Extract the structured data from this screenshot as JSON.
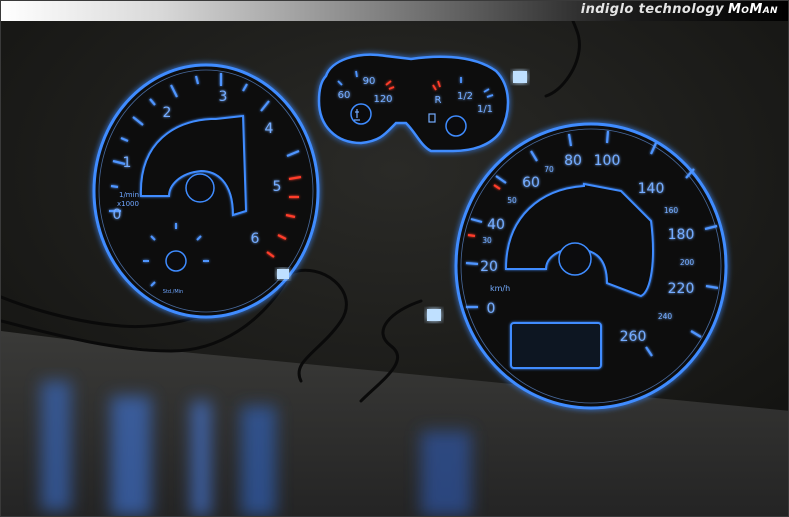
{
  "banner": {
    "tagline": "indiglo technology",
    "brand": "MoMan"
  },
  "tachometer": {
    "numbers": [
      "0",
      "1",
      "2",
      "3",
      "4",
      "5",
      "6"
    ],
    "unit_line1": "1/min",
    "unit_line2": "x1000",
    "clock_label": "Std./Min"
  },
  "temp_gauge": {
    "labels": [
      "60",
      "90",
      "120"
    ]
  },
  "fuel_gauge": {
    "labels": [
      "R",
      "1/2",
      "1/1"
    ]
  },
  "speedometer": {
    "major_labels": [
      "0",
      "20",
      "40",
      "60",
      "80",
      "100",
      "140",
      "180",
      "220",
      "260"
    ],
    "minor_labels": [
      "30",
      "50",
      "70",
      "160",
      "200",
      "240"
    ],
    "unit": "km/h"
  },
  "colors": {
    "glow": "#3f8cff",
    "redline": "#ff3c2a",
    "dial_face": "#0d0d10"
  },
  "icons": [
    "coolant-temp-icon",
    "fuel-pump-icon",
    "wiring-cable-icon"
  ]
}
